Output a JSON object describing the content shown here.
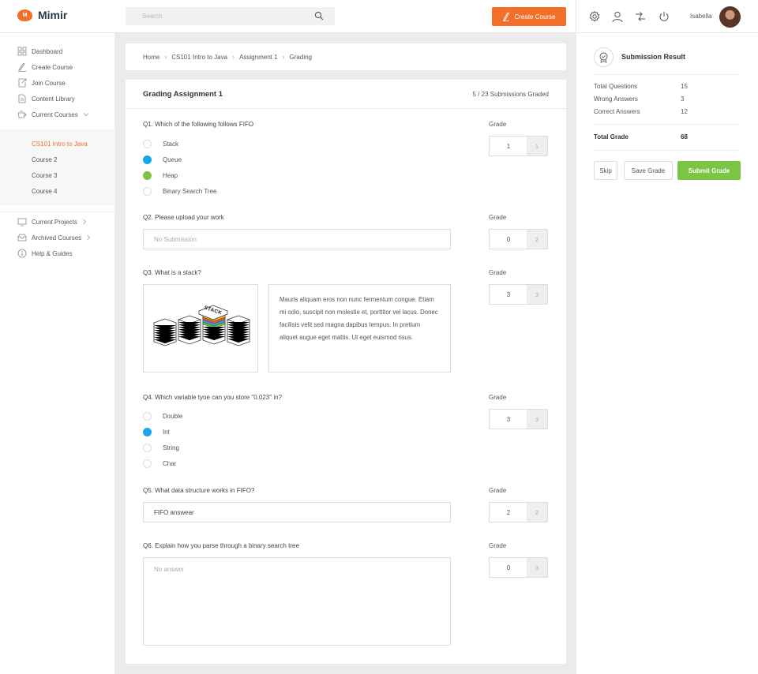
{
  "app": {
    "name": "Mimir",
    "logo_letter": "M"
  },
  "header": {
    "search_placeholder": "Search",
    "create_button": "Create Course",
    "username": "Isabella",
    "icons": [
      "gear-icon",
      "user-icon",
      "swap-icon",
      "power-icon"
    ]
  },
  "sidebar": {
    "items": [
      {
        "label": "Dashboard",
        "icon": "grid-icon"
      },
      {
        "label": "Create Course",
        "icon": "pen-icon"
      },
      {
        "label": "Join Course",
        "icon": "join-icon"
      },
      {
        "label": "Content Library",
        "icon": "document-icon"
      },
      {
        "label": "Current Courses",
        "icon": "cup-icon"
      }
    ],
    "courses": [
      "CS101 Intro to Java",
      "Course 2",
      "Course 3",
      "Course 4"
    ],
    "more": [
      {
        "label": "Current Projects",
        "icon": "projects-icon"
      },
      {
        "label": "Archived Courses",
        "icon": "archive-icon"
      },
      {
        "label": "Help & Guides",
        "icon": "help-icon"
      }
    ]
  },
  "breadcrumb": [
    "Home",
    "CS101 Intro to Java",
    "Assignment 1",
    "Grading"
  ],
  "grading": {
    "title": "Grading Assignment 1",
    "count": "5 / 23 Submissions Graded",
    "grade_label": "Grade",
    "questions": [
      {
        "text": "Q1. Which of the following follows FIFO",
        "options": [
          "Stack",
          "Queue",
          "Heap",
          "Binary Search Tree"
        ],
        "grade": "1",
        "max": "1"
      },
      {
        "text": "Q2. Please upload your work",
        "answer": "No Submission",
        "grade": "0",
        "max": "2"
      },
      {
        "text": "Q3. What is a stack?",
        "image_label": "STACK",
        "answer": "Mauris aliquam eros non nunc fermentum congue. Etiam mi odio, suscipit non molestie et, porttitor vel lacus. Donec facilisis velit sed magna dapibus tempus. In pretium aliquet augue eget mattis. Ut eget euismod risus.",
        "grade": "3",
        "max": "3"
      },
      {
        "text": "Q4. Which variable tyoe can you store \"0.023\" in?",
        "options": [
          "Double",
          "Int",
          "String",
          "Char"
        ],
        "grade": "3",
        "max": "3"
      },
      {
        "text": "Q5. What data structure works in FIFO?",
        "answer": "FIFO answear",
        "grade": "2",
        "max": "2"
      },
      {
        "text": "Q6. Explain how you parse through a binary search tree",
        "answer": "No answer",
        "grade": "0",
        "max": "3"
      }
    ]
  },
  "result": {
    "title": "Submission Result",
    "total_questions_label": "Total Questions",
    "total_questions": "15",
    "wrong_label": "Wrong Answers",
    "wrong": "3",
    "correct_label": "Correct Answers",
    "correct": "12",
    "total_grade_label": "Total Grade",
    "total_grade": "68",
    "skip": "Skip",
    "save": "Save Grade",
    "submit": "Submit Grade"
  },
  "colors": {
    "accent": "#f0702a",
    "selected": "#1aa6e8",
    "correct": "#7cc544"
  }
}
